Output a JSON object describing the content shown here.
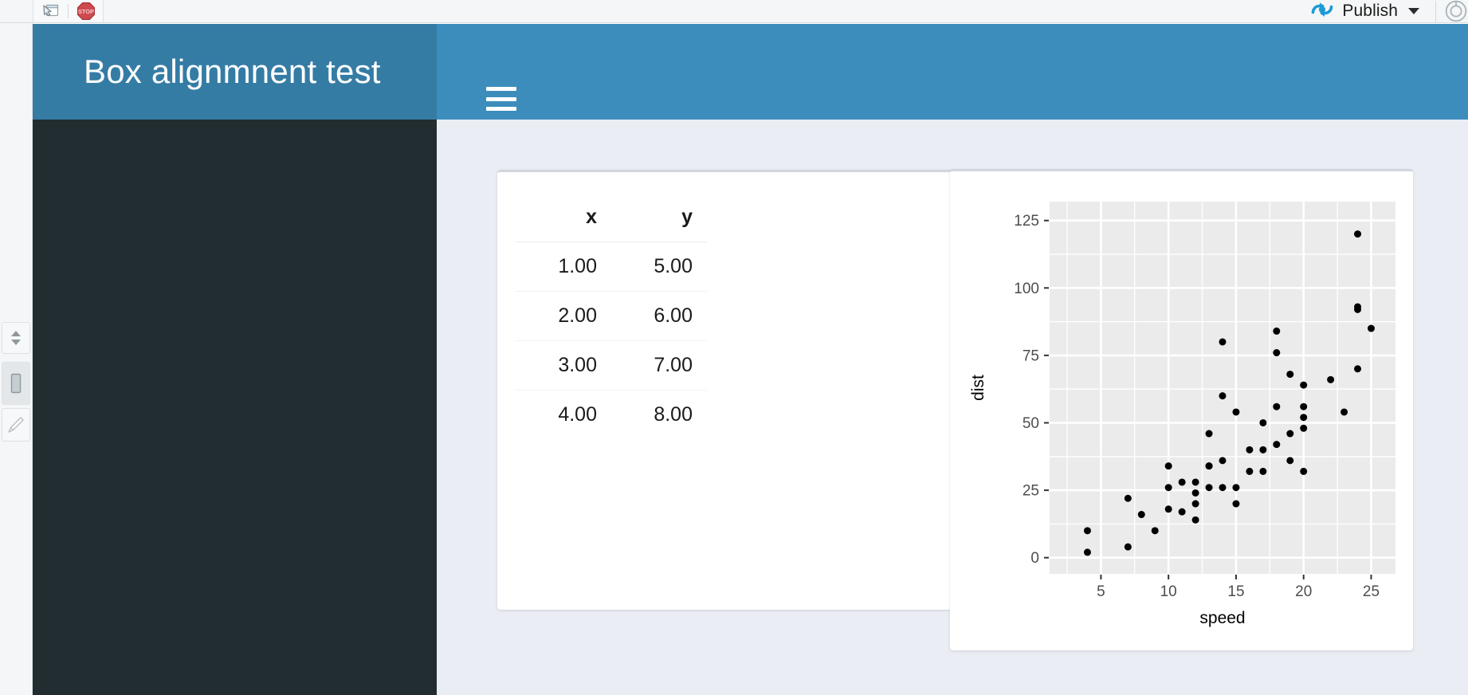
{
  "ide": {
    "toolbar_left_icons": [
      {
        "name": "show-in-new-window-icon",
        "label": "Show in new window"
      },
      {
        "name": "stop-icon",
        "label": "STOP"
      }
    ],
    "publish": {
      "label": "Publish",
      "icon": "publish-icon",
      "caret": "chevron-down-icon"
    },
    "right_edge_icon": "settings-gear-icon",
    "gutter_icons": [
      {
        "name": "scroll-updown-icon",
        "label": "Scroll up/down"
      },
      {
        "name": "pane-layout-icon",
        "label": "Pane layout"
      },
      {
        "name": "edit-pencil-icon",
        "label": "Edit"
      }
    ]
  },
  "app": {
    "header": {
      "title": "Box alignmnent test",
      "menu_toggle_label": "Toggle navigation",
      "logo_bg": "#357ca5",
      "header_bg": "#3c8dbc"
    },
    "sidebar": {
      "bg": "#222d32",
      "items": []
    },
    "content_bg": "#eaedf4"
  },
  "table_card": {
    "columns": [
      "x",
      "y"
    ],
    "rows": [
      [
        "1.00",
        "5.00"
      ],
      [
        "2.00",
        "6.00"
      ],
      [
        "3.00",
        "7.00"
      ],
      [
        "4.00",
        "8.00"
      ]
    ]
  },
  "chart_data": {
    "type": "scatter",
    "title": "",
    "xlabel": "speed",
    "ylabel": "dist",
    "xlim": [
      1.2,
      26.8
    ],
    "ylim": [
      -6,
      132
    ],
    "xticks": [
      5,
      10,
      15,
      20,
      25
    ],
    "yticks": [
      0,
      25,
      50,
      75,
      100,
      125
    ],
    "grid": true,
    "legend": "none",
    "panel_bg": "#ebebeb",
    "grid_color": "#ffffff",
    "point_color": "#000000",
    "point_size": 9,
    "x": [
      4,
      4,
      7,
      7,
      8,
      9,
      10,
      10,
      10,
      11,
      11,
      12,
      12,
      12,
      12,
      13,
      13,
      13,
      13,
      14,
      14,
      14,
      14,
      15,
      15,
      15,
      16,
      16,
      17,
      17,
      17,
      18,
      18,
      18,
      18,
      19,
      19,
      19,
      20,
      20,
      20,
      20,
      20,
      22,
      23,
      24,
      24,
      24,
      24,
      25
    ],
    "y": [
      2,
      10,
      4,
      22,
      16,
      10,
      18,
      26,
      34,
      17,
      28,
      14,
      20,
      24,
      28,
      26,
      34,
      34,
      46,
      26,
      36,
      60,
      80,
      20,
      26,
      54,
      32,
      40,
      32,
      40,
      50,
      42,
      56,
      76,
      84,
      36,
      46,
      68,
      32,
      48,
      52,
      56,
      64,
      66,
      54,
      70,
      92,
      93,
      120,
      85
    ]
  }
}
